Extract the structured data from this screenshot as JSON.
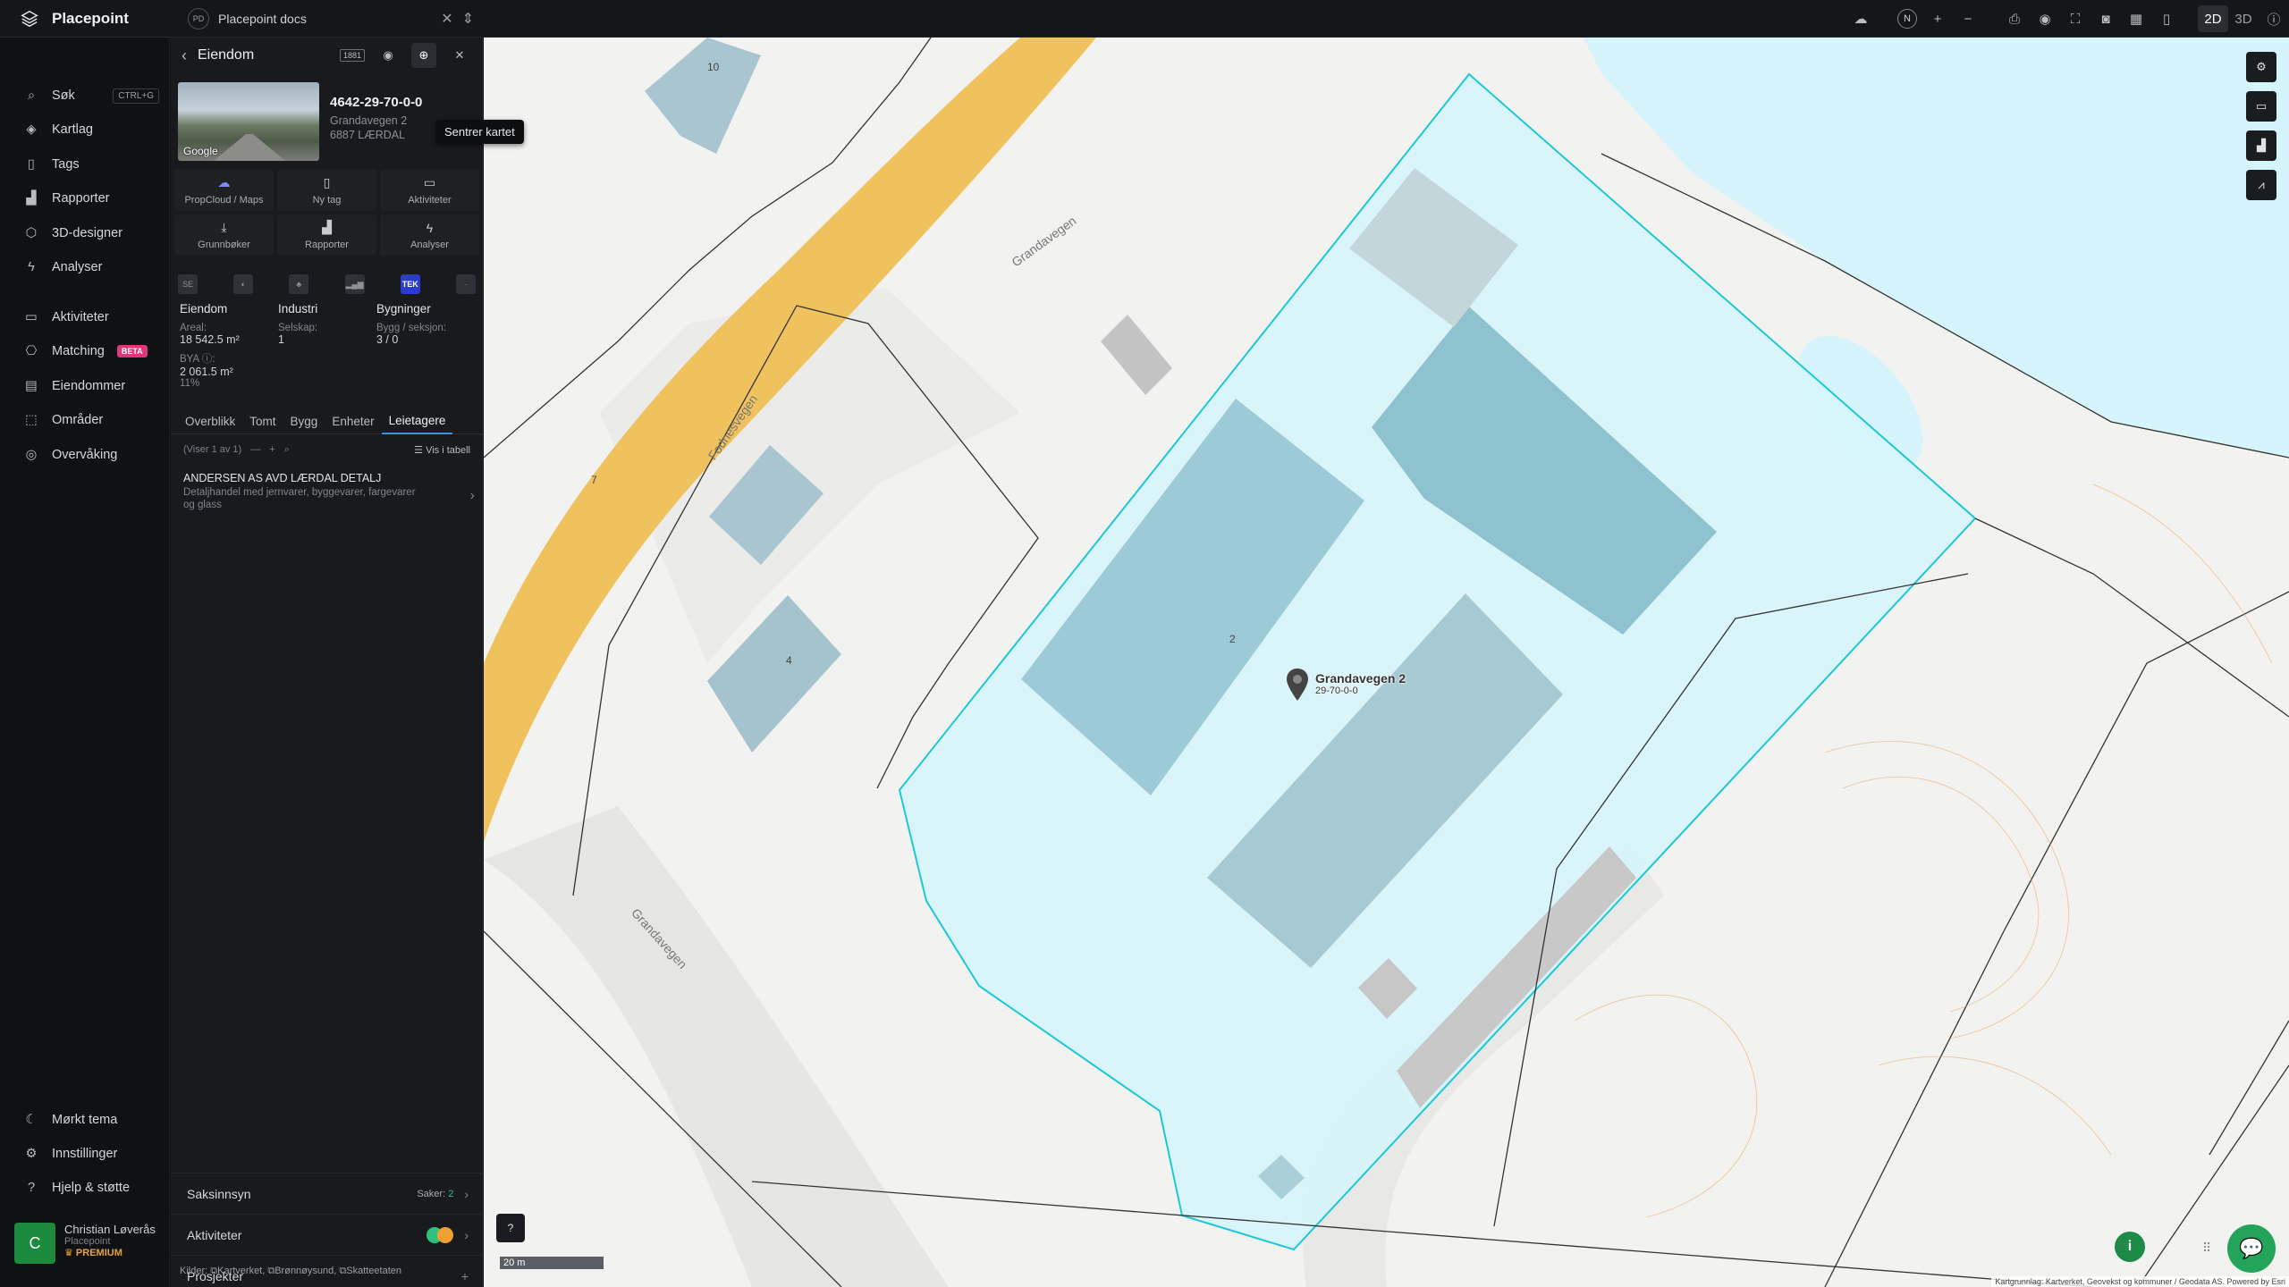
{
  "app": {
    "name": "Placepoint"
  },
  "doc_tab": {
    "badge": "PD",
    "title": "Placepoint docs"
  },
  "nav": {
    "items": [
      {
        "label": "Søk",
        "icon": "search-icon",
        "shortcut": "CTRL+G"
      },
      {
        "label": "Kartlag",
        "icon": "layers-icon"
      },
      {
        "label": "Tags",
        "icon": "bookmark-icon"
      },
      {
        "label": "Rapporter",
        "icon": "chart-icon"
      },
      {
        "label": "3D-designer",
        "icon": "cube-icon"
      },
      {
        "label": "Analyser",
        "icon": "bolt-icon"
      },
      {
        "label": "Aktiviteter",
        "icon": "chat-icon"
      },
      {
        "label": "Matching",
        "icon": "matching-icon",
        "badge": "BETA"
      },
      {
        "label": "Eiendommer",
        "icon": "building-icon"
      },
      {
        "label": "Områder",
        "icon": "area-icon"
      },
      {
        "label": "Overvåking",
        "icon": "monitor-icon"
      }
    ],
    "bottom": [
      {
        "label": "Mørkt tema",
        "icon": "moon-icon"
      },
      {
        "label": "Innstillinger",
        "icon": "gear-icon"
      },
      {
        "label": "Hjelp & støtte",
        "icon": "help-icon"
      }
    ]
  },
  "user": {
    "initial": "C",
    "name": "Christian Løverås",
    "org": "Placepoint",
    "plan": "PREMIUM"
  },
  "panel": {
    "title": "Eiendom",
    "tooltip": "Sentrer kartet",
    "header_badge": "1881",
    "property": {
      "number": "4642-29-70-0-0",
      "street": "Grandavegen 2",
      "postal": "6887 LÆRDAL",
      "photo_credit": "Google"
    },
    "actions": [
      {
        "label": "PropCloud / Maps",
        "icon": "cloud-icon"
      },
      {
        "label": "Ny tag",
        "icon": "bookmark-icon"
      },
      {
        "label": "Aktiviteter",
        "icon": "chat-icon"
      },
      {
        "label": "Grunnbøker",
        "icon": "download-icon"
      },
      {
        "label": "Rapporter",
        "icon": "chart-icon"
      },
      {
        "label": "Analyser",
        "icon": "bolt-icon"
      }
    ],
    "sources": [
      "SE",
      "◐",
      "♣",
      "▂▄▆",
      "TEK",
      "·"
    ],
    "stats": {
      "eiendom": {
        "heading": "Eiendom",
        "areal_label": "Areal:",
        "areal_value": "18 542.5",
        "areal_unit": "m²",
        "bya_label": "BYA ⓘ:",
        "bya_value": "2 061.5",
        "bya_unit": "m²",
        "bya_pct": "11%"
      },
      "industri": {
        "heading": "Industri",
        "selskap_label": "Selskap:",
        "selskap_value": "1"
      },
      "bygninger": {
        "heading": "Bygninger",
        "bygg_label": "Bygg / seksjon:",
        "bygg_value": "3 / 0"
      }
    },
    "tabs": [
      "Overblikk",
      "Tomt",
      "Bygg",
      "Enheter",
      "Leietagere"
    ],
    "active_tab": "Leietagere",
    "listbar": {
      "count": "(Viser 1 av 1)",
      "table_label": "Vis i tabell"
    },
    "tenant": {
      "name": "ANDERSEN AS AVD LÆRDAL DETALJ",
      "desc": "Detaljhandel med jernvarer, byggevarer, fargevarer og glass"
    },
    "bottom": {
      "saksinnsyn": {
        "label": "Saksinnsyn",
        "meta_label": "Saker:",
        "meta_value": "2"
      },
      "aktiviteter": {
        "label": "Aktiviteter"
      },
      "prosjekter": {
        "label": "Prosjekter",
        "action": "+"
      }
    },
    "sources_footer": {
      "label": "Kilder:",
      "items": [
        "Kartverket,",
        "Brønnøysund,",
        "Skatteetaten"
      ]
    }
  },
  "toolbar": {
    "compass": "N",
    "mode_2d": "2D",
    "mode_3d": "3D"
  },
  "map": {
    "marker": {
      "address": "Grandavegen 2",
      "id": "29-70-0-0"
    },
    "road_labels": [
      "Grandavegen",
      "Fodnesvegen",
      "Grandavegen"
    ],
    "scale": "20 m",
    "attribution": "Kartgrunnlag: Kartverket, Geovekst og kommuner / Geodata AS. Powered by Esri",
    "building_numbers": [
      "10",
      "7",
      "4",
      "2"
    ],
    "colors": {
      "water": "#d6f4fb",
      "road": "#f0c25e",
      "building": "#9ccad6",
      "selection": "#1cc8d6",
      "accent": "#24a35a"
    }
  }
}
